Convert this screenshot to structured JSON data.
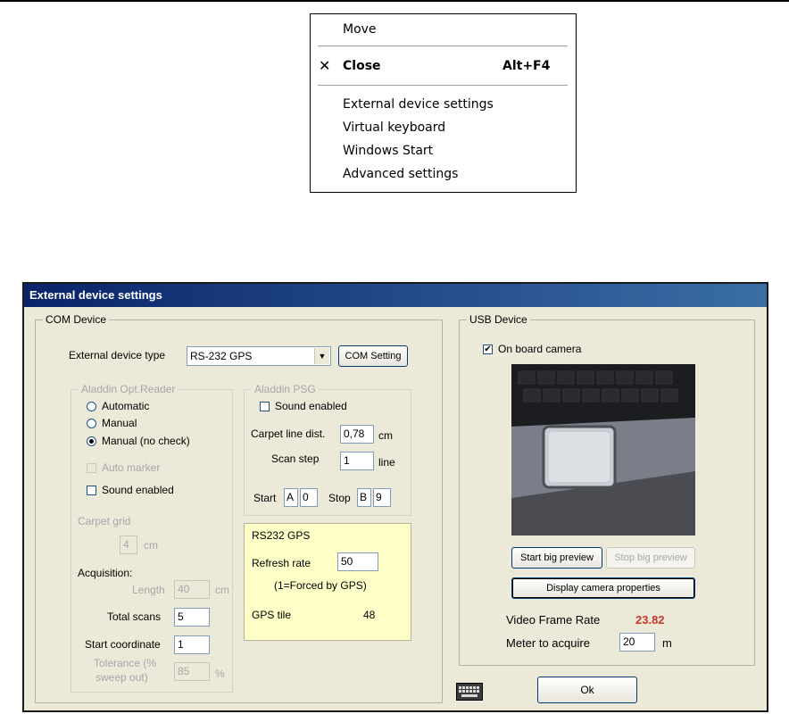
{
  "context_menu": {
    "items": [
      {
        "label": "Move"
      },
      {
        "label": "Close",
        "shortcut": "Alt+F4"
      },
      {
        "label": "External device settings"
      },
      {
        "label": "Virtual keyboard"
      },
      {
        "label": "Windows Start"
      },
      {
        "label": "Advanced settings"
      }
    ]
  },
  "dialog": {
    "title": "External device settings",
    "com_device": {
      "legend": "COM Device",
      "device_type_label": "External device type",
      "device_type_value": "RS-232 GPS",
      "com_setting_button": "COM Setting",
      "opt_reader": {
        "legend": "Aladdin Opt.Reader",
        "radio_automatic": "Automatic",
        "radio_manual": "Manual",
        "radio_manual_nocheck": "Manual (no check)",
        "auto_marker": "Auto marker",
        "sound_enabled": "Sound enabled",
        "carpet_grid_label": "Carpet grid",
        "carpet_grid_value": "4",
        "carpet_grid_unit": "cm",
        "acquisition_label": "Acquisition:",
        "length_label": "Length",
        "length_value": "40",
        "length_unit": "cm",
        "total_scans_label": "Total scans",
        "total_scans_value": "5",
        "start_coord_label": "Start coordinate",
        "start_coord_value": "1",
        "tolerance_label_1": "Tolerance (%",
        "tolerance_label_2": "sweep out)",
        "tolerance_value": "85",
        "tolerance_unit": "%"
      },
      "psg": {
        "legend": "Aladdin PSG",
        "sound_enabled": "Sound enabled",
        "carpet_line_label": "Carpet line dist.",
        "carpet_line_value": "0,78",
        "carpet_line_unit": "cm",
        "scan_step_label": "Scan step",
        "scan_step_value": "1",
        "scan_step_unit": "line",
        "start_label": "Start",
        "start_letter": "A",
        "start_num": "0",
        "stop_label": "Stop",
        "stop_letter": "B",
        "stop_num": "9"
      },
      "gps": {
        "legend": "RS232 GPS",
        "refresh_label": "Refresh rate",
        "refresh_value": "50",
        "refresh_note": "(1=Forced by GPS)",
        "tile_label": "GPS tile",
        "tile_value": "48"
      }
    },
    "usb_device": {
      "legend": "USB Device",
      "onboard_camera": "On board camera",
      "start_preview_button": "Start big preview",
      "stop_preview_button": "Stop big preview",
      "camera_props_button": "Display camera properties",
      "frame_rate_label": "Video Frame Rate",
      "frame_rate_value": "23.82",
      "meter_label": "Meter to acquire",
      "meter_value": "20",
      "meter_unit": "m"
    },
    "ok_button": "Ok",
    "colors": {
      "title_start": "#0a246a",
      "title_end": "#3a6ea5",
      "gps_bg": "#ffffc8",
      "frame_rate": "#c0392b"
    },
    "icons": {
      "keyboard": "keyboard-icon",
      "checkmark": "checkmark-icon",
      "close": "close-x-icon",
      "dropdown": "chevron-down-icon"
    }
  }
}
